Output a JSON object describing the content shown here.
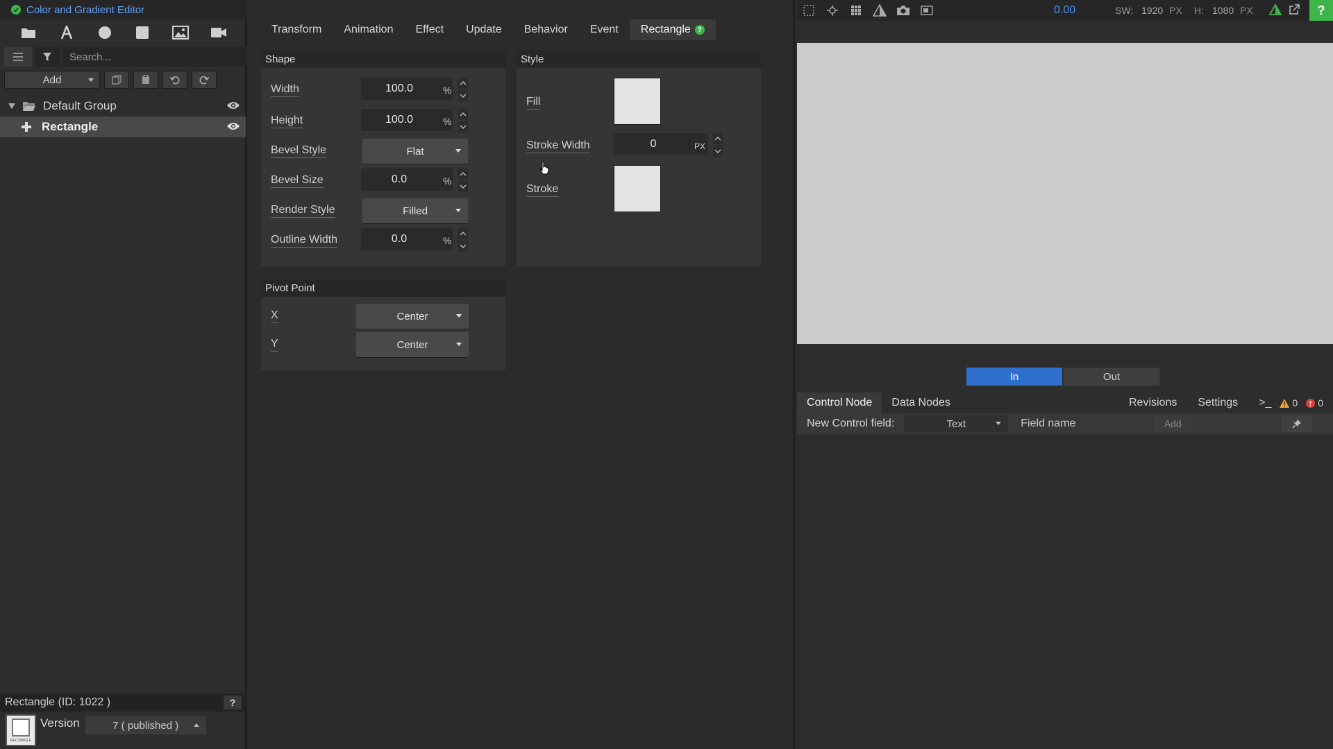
{
  "window": {
    "title": "Color and Gradient Editor"
  },
  "left": {
    "tools": [
      "folder-icon",
      "text-icon",
      "circle-icon",
      "square-icon",
      "image-icon",
      "video-icon"
    ],
    "search_placeholder": "Search...",
    "add_label": "Add",
    "tree": [
      {
        "label": "Default Group",
        "type": "group",
        "expanded": true
      },
      {
        "label": "Rectangle",
        "type": "shape",
        "selected": true
      }
    ],
    "status_text": "Rectangle (ID: 1022 )",
    "help_label": "?",
    "version_label": "Version",
    "version_value": "7 ( published )",
    "thumb_caption": "RECTANGLE"
  },
  "tabs": [
    {
      "label": "Transform"
    },
    {
      "label": "Animation"
    },
    {
      "label": "Effect"
    },
    {
      "label": "Update"
    },
    {
      "label": "Behavior"
    },
    {
      "label": "Event"
    },
    {
      "label": "Rectangle",
      "active": true,
      "help": "?"
    }
  ],
  "shape": {
    "header": "Shape",
    "width": {
      "label": "Width",
      "value": "100.0",
      "unit": "%"
    },
    "height": {
      "label": "Height",
      "value": "100.0",
      "unit": "%"
    },
    "bevel_style": {
      "label": "Bevel Style",
      "value": "Flat"
    },
    "bevel_size": {
      "label": "Bevel Size",
      "value": "0.0",
      "unit": "%"
    },
    "render_style": {
      "label": "Render Style",
      "value": "Filled"
    },
    "outline_width": {
      "label": "Outline Width",
      "value": "0.0",
      "unit": "%"
    }
  },
  "style": {
    "header": "Style",
    "fill": {
      "label": "Fill",
      "color": "#e4e4e4"
    },
    "stroke_width": {
      "label": "Stroke Width",
      "value": "0",
      "unit": "PX"
    },
    "stroke": {
      "label": "Stroke",
      "color": "#e4e4e4"
    }
  },
  "pivot": {
    "header": "Pivot Point",
    "x": {
      "label": "X",
      "value": "Center"
    },
    "y": {
      "label": "Y",
      "value": "Center"
    }
  },
  "right": {
    "toolbar_icons": [
      "safe-area-icon",
      "crosshair-icon",
      "grid-icon",
      "alpha-icon",
      "camera-icon",
      "snapshot-icon"
    ],
    "timecode": "0.00",
    "sw_label": "SW:",
    "sw_value": "1920",
    "sw_unit": "PX",
    "h_label": "H:",
    "h_value": "1080",
    "h_unit": "PX",
    "help_label": "?",
    "preview_color": "#cbcbcb",
    "in_label": "In",
    "out_label": "Out",
    "control_tabs": [
      {
        "label": "Control Node",
        "active": true
      },
      {
        "label": "Data Nodes"
      }
    ],
    "revisions_label": "Revisions",
    "settings_label": "Settings",
    "console_label": ">_",
    "warning_count": "0",
    "error_count": "0",
    "new_field_label": "New Control field:",
    "field_type": "Text",
    "field_name_placeholder": "Field name",
    "field_add_label": "Add"
  },
  "colors": {
    "accent": "#2e6fcb",
    "ok": "#3db54a",
    "timecode": "#4d8fff",
    "warning": "#f0a020",
    "error": "#e0403a"
  }
}
